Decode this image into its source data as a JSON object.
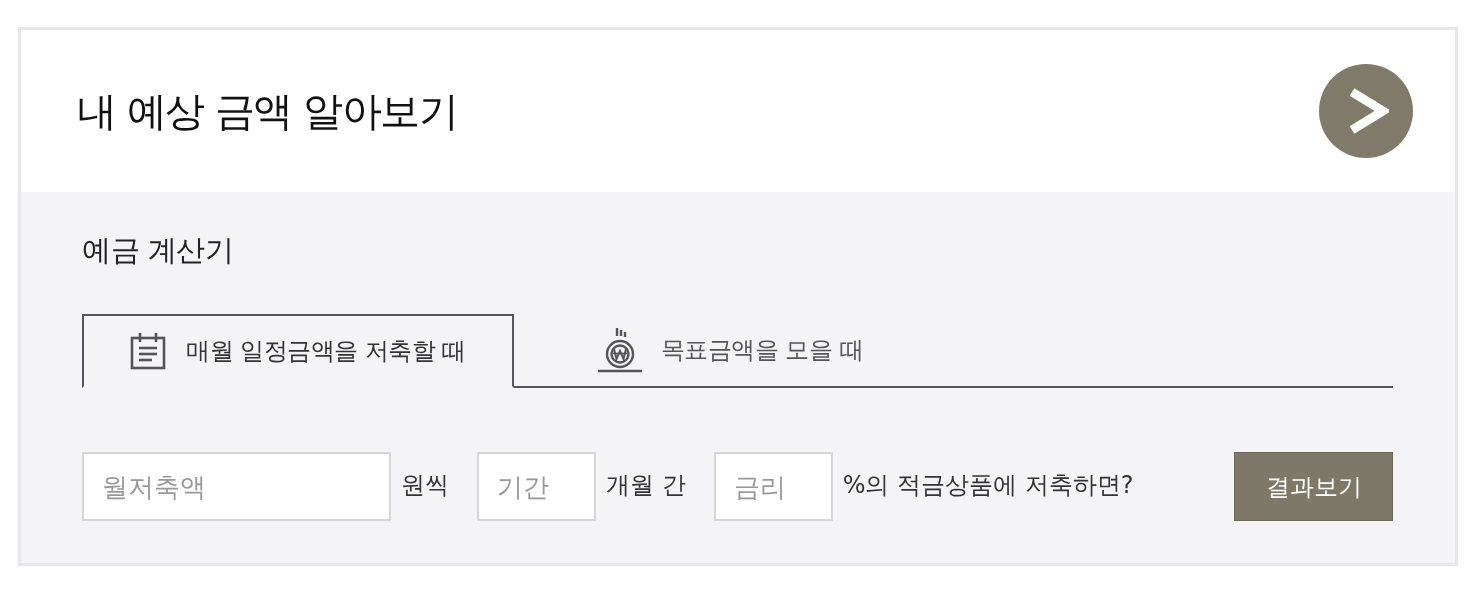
{
  "header": {
    "title": "내 예상 금액 알아보기"
  },
  "calculator": {
    "title": "예금 계산기",
    "tabs": [
      {
        "label": "매월 일정금액을 저축할 때",
        "selected": true
      },
      {
        "label": "목표금액을 모을 때",
        "selected": false
      }
    ],
    "form": [
      {
        "kind": "input",
        "placeholder": "월저축액"
      },
      {
        "kind": "label",
        "text": "원씩"
      },
      {
        "kind": "input",
        "placeholder": "기간"
      },
      {
        "kind": "label",
        "text": "개월 간"
      },
      {
        "kind": "input",
        "placeholder": "금리"
      },
      {
        "kind": "label",
        "text": "%의 적금상품에 저축하면?"
      }
    ],
    "submit": {
      "label": "결과보기"
    }
  }
}
